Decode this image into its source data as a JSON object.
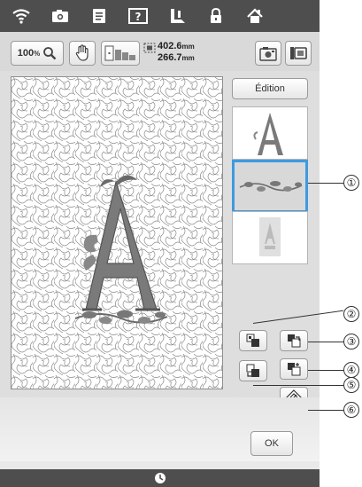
{
  "toolbar": {
    "zoom_value": "100",
    "zoom_unit": "%",
    "width_value": "402.6",
    "height_value": "266.7",
    "unit": "mm"
  },
  "side_panel": {
    "edition_label": "Édition",
    "ok_label": "OK"
  },
  "callouts": [
    "①",
    "②",
    "③",
    "④",
    "⑤",
    "⑥"
  ],
  "colors": {
    "bar": "#4e4e4e",
    "selection": "#3d9be0",
    "letter": "#7a7a7a"
  }
}
